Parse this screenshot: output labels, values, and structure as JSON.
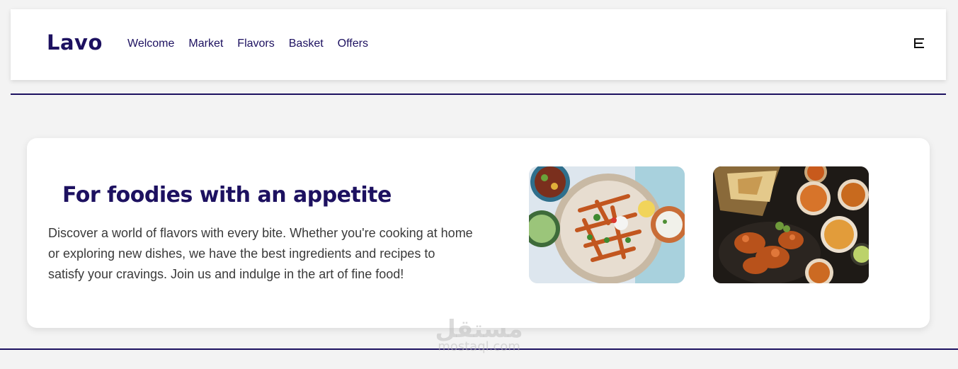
{
  "header": {
    "logo": "Lavo",
    "nav": [
      {
        "label": "Welcome"
      },
      {
        "label": "Market"
      },
      {
        "label": "Flavors"
      },
      {
        "label": "Basket"
      },
      {
        "label": "Offers"
      }
    ],
    "menu_icon": "menu-lines-icon"
  },
  "hero": {
    "title": "For foodies with an appetite",
    "description": "Discover a world of flavors with every bite. Whether you're cooking at home or exploring new dishes, we have the best ingredients and recipes to satisfy your cravings. Join us and indulge in the art of fine food!"
  },
  "watermark": {
    "arabic": "مستقل",
    "latin": "mostaql.com"
  },
  "colors": {
    "brand": "#1d1160",
    "background": "#f3f3f3",
    "card": "#ffffff"
  }
}
